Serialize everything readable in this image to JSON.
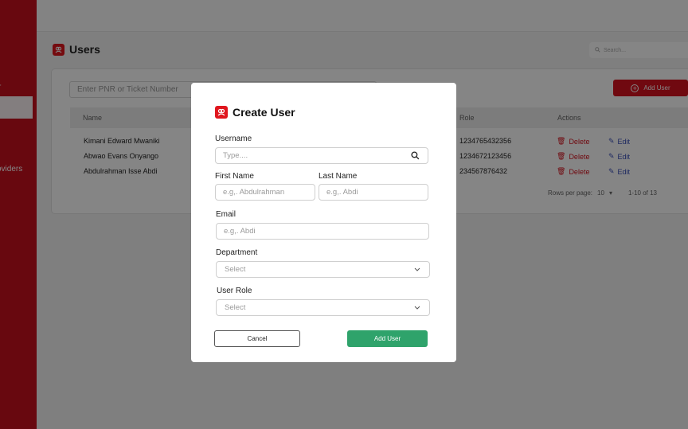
{
  "sidebar": {
    "items": [
      {
        "label": "r"
      },
      {
        "label": ""
      },
      {
        "label": "oviders"
      }
    ]
  },
  "header": {
    "search_placeholder": "Search..."
  },
  "page": {
    "title": "Users",
    "pnr_placeholder": "Enter PNR or Ticket Number",
    "add_user_label": "Add User",
    "columns": [
      "Name",
      "Role",
      "Actions"
    ],
    "rows": [
      {
        "name": "Kimani Edward Mwaniki",
        "role": "1234765432356",
        "delete": "Delete",
        "edit": "Edit"
      },
      {
        "name": "Abwao Evans Onyango",
        "role": "1234672123456",
        "delete": "Delete",
        "edit": "Edit"
      },
      {
        "name": "Abdulrahman Isse Abdi",
        "role": "234567876432",
        "delete": "Delete",
        "edit": "Edit"
      }
    ],
    "rows_per_page_label": "Rows per page:",
    "rows_per_page_value": "10",
    "range_text": "1-10 of 13"
  },
  "modal": {
    "title": "Create User",
    "username_label": "Username",
    "username_placeholder": "Type....",
    "first_name_label": "First Name",
    "first_name_placeholder": "e.g,. Abdulrahman",
    "last_name_label": "Last Name",
    "last_name_placeholder": "e.g,. Abdi",
    "email_label": "Email",
    "email_placeholder": "e.g,. Abdi",
    "department_label": "Department",
    "department_value": "Select",
    "role_label": "User Role",
    "role_value": "Select",
    "cancel_label": "Cancel",
    "add_label": "Add User"
  },
  "colors": {
    "brand_red": "#d7131f",
    "sidebar_red": "#c8101e",
    "success_green": "#2fa36b",
    "edit_blue": "#3a4fb8"
  }
}
